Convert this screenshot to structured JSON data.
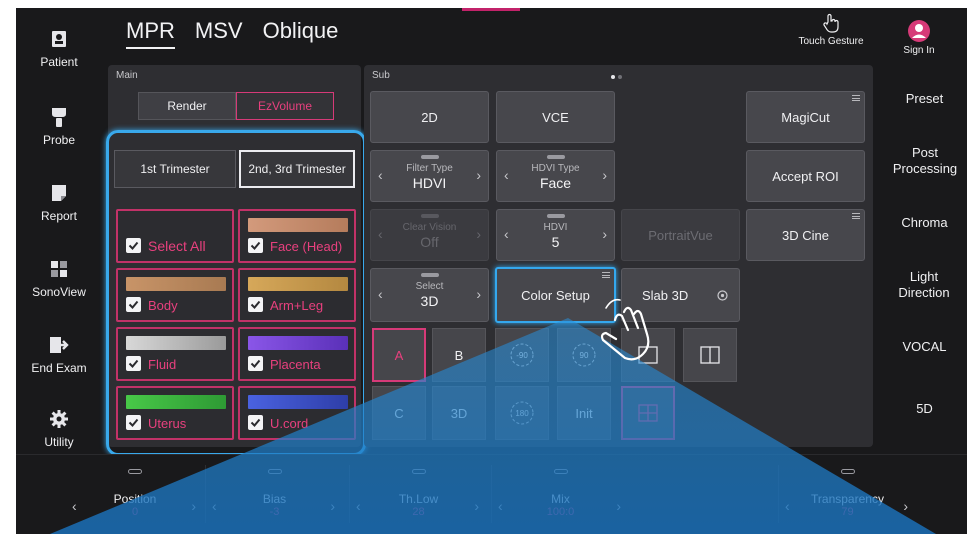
{
  "mode_tabs": [
    {
      "label": "MPR",
      "active": true
    },
    {
      "label": "MSV",
      "active": false
    },
    {
      "label": "Oblique",
      "active": false
    }
  ],
  "top_right": {
    "touch_gesture": "Touch Gesture",
    "sign_in": "Sign In"
  },
  "left_nav": [
    {
      "label": "Patient",
      "icon": "patient-icon"
    },
    {
      "label": "Probe",
      "icon": "probe-icon"
    },
    {
      "label": "Report",
      "icon": "report-icon"
    },
    {
      "label": "SonoView",
      "icon": "sonoview-icon"
    },
    {
      "label": "End Exam",
      "icon": "end-exam-icon"
    },
    {
      "label": "Utility",
      "icon": "gear-icon"
    }
  ],
  "right_nav": [
    "Preset",
    "Post Processing",
    "Chroma",
    "Light Direction",
    "VOCAL",
    "5D"
  ],
  "main_panel": {
    "title": "Main",
    "render": "Render",
    "ezvolume": "EzVolume",
    "trimester_1": "1st Trimester",
    "trimester_23": "2nd, 3rd Trimester",
    "swatches": [
      {
        "label": "Select All",
        "color": ""
      },
      {
        "label": "Face (Head)",
        "color": "#c98a6a"
      },
      {
        "label": "Body",
        "color": "#b88860"
      },
      {
        "label": "Arm+Leg",
        "color": "#c89a50"
      },
      {
        "label": "Fluid",
        "color": "#bdbdbd"
      },
      {
        "label": "Placenta",
        "color": "#7a48d8"
      },
      {
        "label": "Uterus",
        "color": "#3fc040"
      },
      {
        "label": "U.cord",
        "color": "#3e58d8"
      }
    ]
  },
  "sub_panel": {
    "title": "Sub",
    "btn_2d": "2D",
    "btn_vce": "VCE",
    "btn_magicut": "MagiCut",
    "filter_type": {
      "label": "Filter Type",
      "value": "HDVI"
    },
    "hdvi_type": {
      "label": "HDVI Type",
      "value": "Face"
    },
    "accept_roi": "Accept ROI",
    "clear_vision": {
      "label": "Clear Vision",
      "value": "Off"
    },
    "hdvi": {
      "label": "HDVI",
      "value": "5"
    },
    "portraitvue": "PortraitVue",
    "cine_3d": "3D Cine",
    "select": {
      "label": "Select",
      "value": "3D"
    },
    "color_setup": "Color Setup",
    "slab_3d": "Slab 3D",
    "grid": {
      "a": "A",
      "b": "B",
      "c": "C",
      "d3": "3D",
      "rot_neg90": "-90",
      "rot_90": "90",
      "rot_180": "180",
      "init": "Init"
    }
  },
  "bottom_bar": [
    {
      "name": "Position",
      "value": "0"
    },
    {
      "name": "Bias",
      "value": "-3"
    },
    {
      "name": "Th.Low",
      "value": "28"
    },
    {
      "name": "Mix",
      "value": "100:0"
    },
    {
      "name": "Transparency",
      "value": "79"
    }
  ],
  "accent_colors": {
    "pink": "#d63a78",
    "blue": "#39a9ec"
  }
}
